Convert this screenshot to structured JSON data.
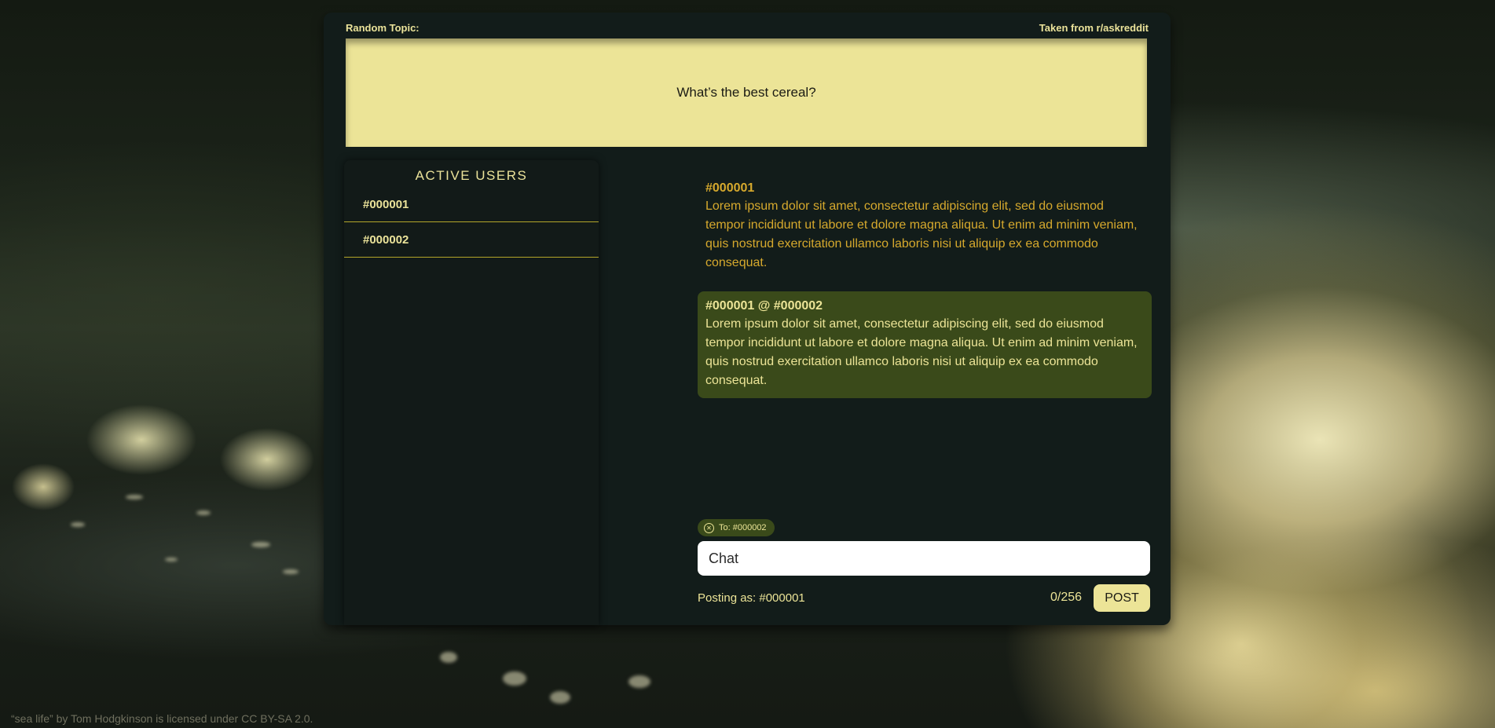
{
  "header": {
    "left_label": "Random Topic:",
    "right_label": "Taken from r/askreddit"
  },
  "topic": {
    "question": "What’s the best cereal?"
  },
  "users": {
    "title": "ACTIVE USERS",
    "items": [
      {
        "name": "#000001"
      },
      {
        "name": "#000002"
      }
    ]
  },
  "messages": [
    {
      "author": "#000001",
      "text": "Lorem ipsum dolor sit amet, consectetur adipiscing elit, sed do eiusmod tempor incididunt ut labore et dolore magna aliqua. Ut enim ad minim veniam, quis nostrud exercitation ullamco laboris nisi ut aliquip ex ea commodo consequat.",
      "type": "public"
    },
    {
      "author": "#000001 @ #000002",
      "text": "Lorem ipsum dolor sit amet, consectetur adipiscing elit, sed do eiusmod tempor incididunt ut labore et dolore magna aliqua. Ut enim ad minim veniam, quis nostrud exercitation ullamco laboris nisi ut aliquip ex ea commodo consequat.",
      "type": "whisper"
    }
  ],
  "composer": {
    "recipient_chip": "To: #000002",
    "recipient_close_icon": "close-circle-icon",
    "placeholder": "Chat",
    "posting_as": "Posting as: #000001",
    "counter": "0/256",
    "post_label": "POST"
  },
  "footer": {
    "credit": "“sea life” by Tom Hodgkinson is licensed under CC BY-SA 2.0."
  },
  "colors": {
    "accent": "#ece497",
    "public_author": "#d6a92d",
    "whisper_bg": "#3a4a1a",
    "panel_bg": "#121c1a"
  }
}
